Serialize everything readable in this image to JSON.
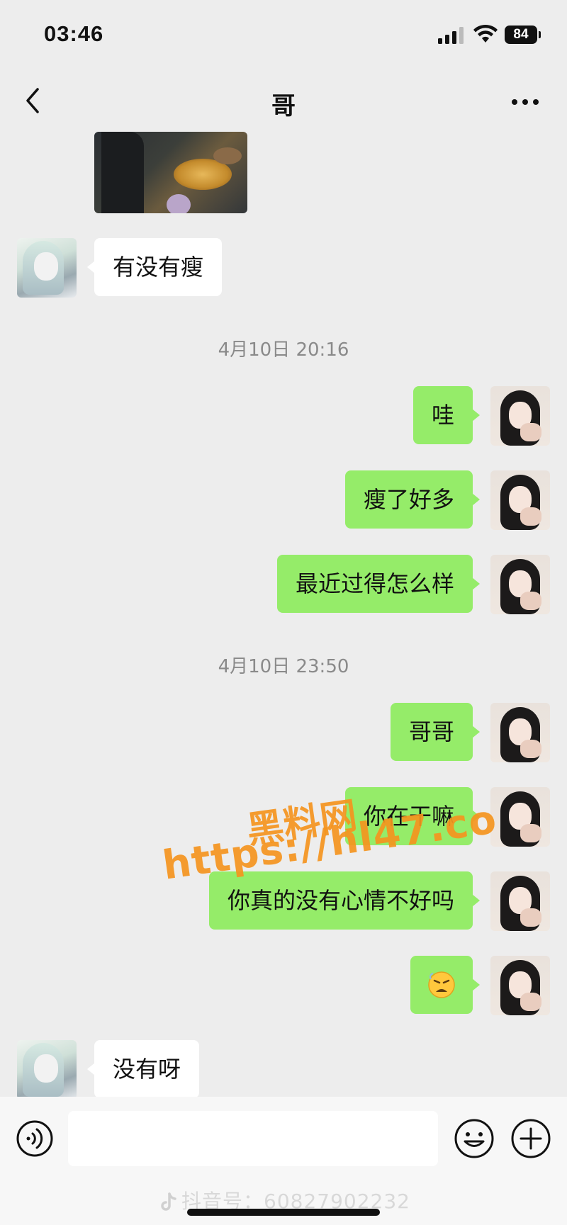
{
  "status_bar": {
    "time": "03:46",
    "battery": "84",
    "icons": [
      "signal-icon",
      "wifi-icon",
      "battery-icon"
    ]
  },
  "nav": {
    "title": "哥",
    "back_icon": "chevron-left-icon",
    "more_icon": "more-dots-icon"
  },
  "messages": [
    {
      "side": "left",
      "type": "image",
      "content": "hotpot photo"
    },
    {
      "side": "left",
      "type": "text",
      "text": "有没有瘦"
    },
    {
      "type": "timestamp",
      "text": "4月10日 20:16"
    },
    {
      "side": "right",
      "type": "text",
      "text": "哇"
    },
    {
      "side": "right",
      "type": "text",
      "text": "瘦了好多"
    },
    {
      "side": "right",
      "type": "text",
      "text": "最近过得怎么样"
    },
    {
      "type": "timestamp",
      "text": "4月10日 23:50"
    },
    {
      "side": "right",
      "type": "text",
      "text": "哥哥"
    },
    {
      "side": "right",
      "type": "text",
      "text": "你在干嘛"
    },
    {
      "side": "right",
      "type": "text",
      "text": "你真的没有心情不好吗"
    },
    {
      "side": "right",
      "type": "emoji",
      "emoji": "angry-face-emoji"
    },
    {
      "side": "left",
      "type": "text",
      "text": "没有呀"
    }
  ],
  "watermark": {
    "line1": "黑料网",
    "line2": "https://hl47.co",
    "color": "#f5951f"
  },
  "input_bar": {
    "value": "",
    "icons": [
      "voice-icon",
      "emoji-icon",
      "plus-icon"
    ]
  },
  "footer_mark": "抖音号：60827902232",
  "colors": {
    "background": "#ededed",
    "bubble_self": "#95ec69",
    "bubble_other": "#ffffff",
    "timestamp": "#8a8a8a"
  }
}
